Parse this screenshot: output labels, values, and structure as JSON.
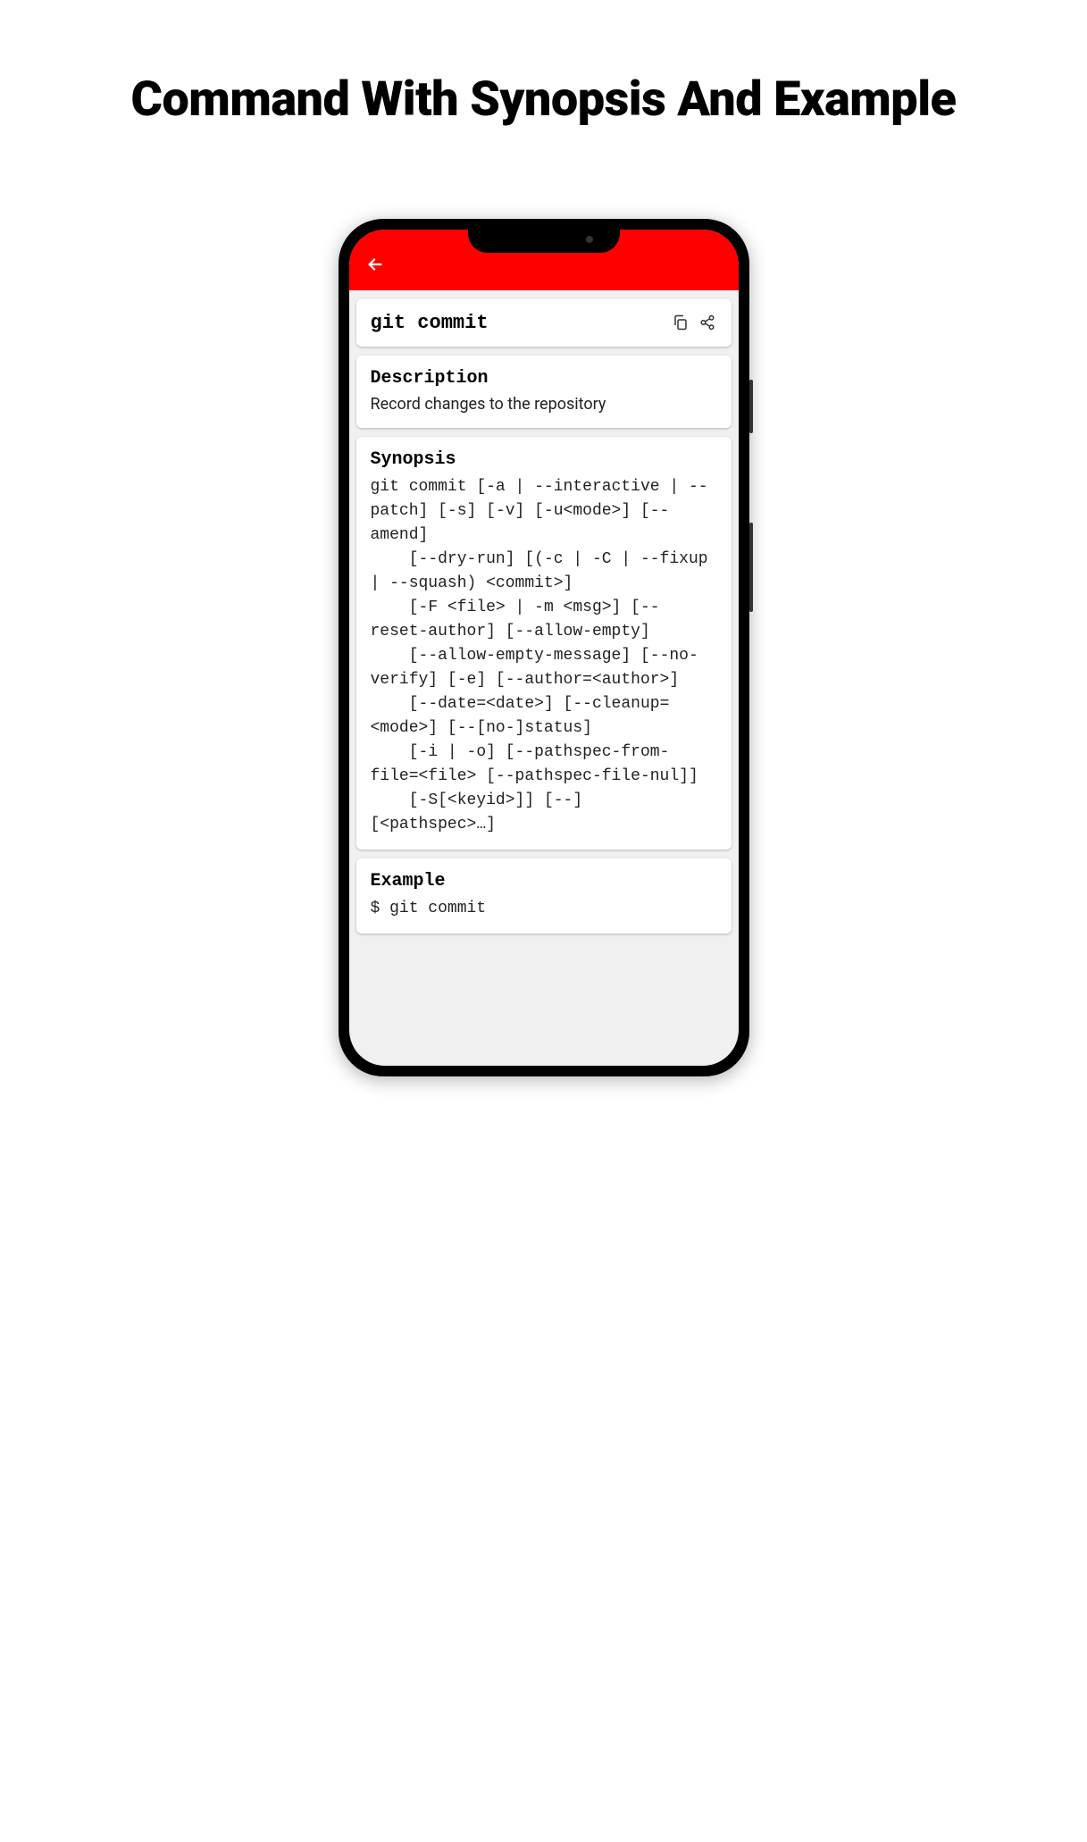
{
  "page": {
    "heading": "Command With Synopsis And Example"
  },
  "header": {
    "command_name": "git commit"
  },
  "description": {
    "label": "Description",
    "text": "Record changes to the repository"
  },
  "synopsis": {
    "label": "Synopsis",
    "text": "git commit [-a | --interactive | --patch] [-s] [-v] [-u<mode>] [--amend]\n    [--dry-run] [(-c | -C | --fixup | --squash) <commit>]\n    [-F <file> | -m <msg>] [--reset-author] [--allow-empty]\n    [--allow-empty-message] [--no-verify] [-e] [--author=<author>]\n    [--date=<date>] [--cleanup=<mode>] [--[no-]status]\n    [-i | -o] [--pathspec-from-file=<file> [--pathspec-file-nul]]\n    [-S[<keyid>]] [--] [<pathspec>…]"
  },
  "example": {
    "label": "Example",
    "text": "$ git commit"
  },
  "icons": {
    "copy": "copy-icon",
    "share": "share-icon",
    "back": "back-arrow-icon"
  }
}
